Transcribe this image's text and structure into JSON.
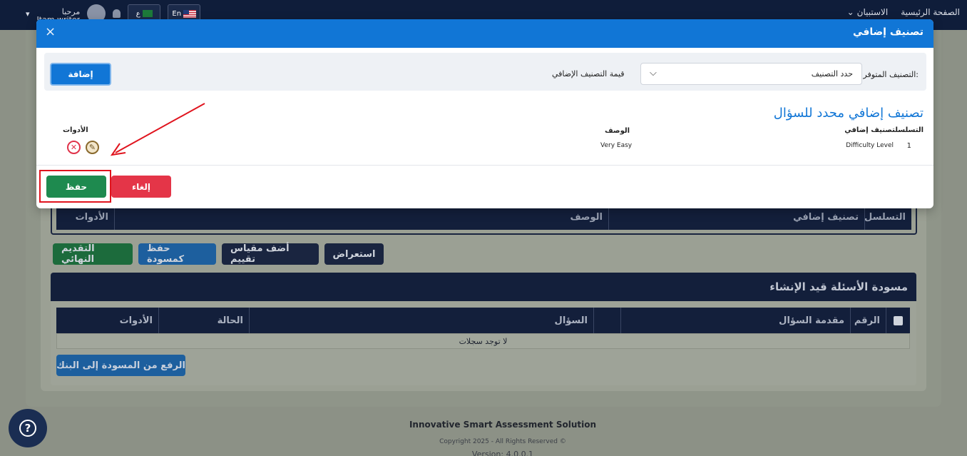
{
  "topbar": {
    "nav_home": "الصفحة الرئيسية",
    "nav_questionnaires": "الاستبيان",
    "greeting": "مرحبا",
    "user_name": "Itam writer",
    "lang_en": "En",
    "lang_ar": "ع"
  },
  "background": {
    "table_cols": [
      "التسلسل",
      "تصنيف إضافي",
      "الوصف",
      "الأدوات"
    ],
    "buttons": {
      "final_submit": "التقديم النهائي",
      "save_draft": "حفظ كمسودة",
      "add_rating_scale": "أضف مقياس تقييم",
      "preview": "استعراض"
    },
    "drafts": {
      "title": "مسودة الأسئلة قيد الإنشاء",
      "cols": [
        "الرقم",
        "مقدمة السؤال",
        "السؤال",
        "الحالة",
        "الأدوات"
      ],
      "empty": "لا توجد سجلات",
      "upload_button": "الرفع من المسودة إلى البنك"
    }
  },
  "footer": {
    "title": "Innovative Smart Assessment Solution",
    "copyright": "Copyright 2025 - All Rights Reserved ©",
    "version": "Version: 4.0.0.1"
  },
  "modal": {
    "title": "تصنيف إضافي",
    "close": "×",
    "available_label": "التصنيف المتوفر:",
    "select_value": "حدد التصنيف",
    "value_label": "قيمة التصنيف الإضافي",
    "add_button": "إضافة",
    "section_title": "تصنيف إضافي محدد للسؤال",
    "col_seq_cls": "التسلسلتصنيف إضافي",
    "col_desc": "الوصف",
    "col_tools": "الأدوات",
    "rows": [
      {
        "seq": "1",
        "classification": "Difficulty Level",
        "description": "Very Easy"
      }
    ],
    "save_button": "حفظ",
    "cancel_button": "إلغاء"
  },
  "icons": {
    "delete": "delete-icon",
    "edit": "edit-icon",
    "help": "help-icon",
    "close": "close-icon",
    "chevron": "chevron-down-icon"
  },
  "colors": {
    "modal_header": "#1176d6",
    "save": "#1e8a4f",
    "cancel": "#e43548",
    "annotation": "#e0141e"
  }
}
